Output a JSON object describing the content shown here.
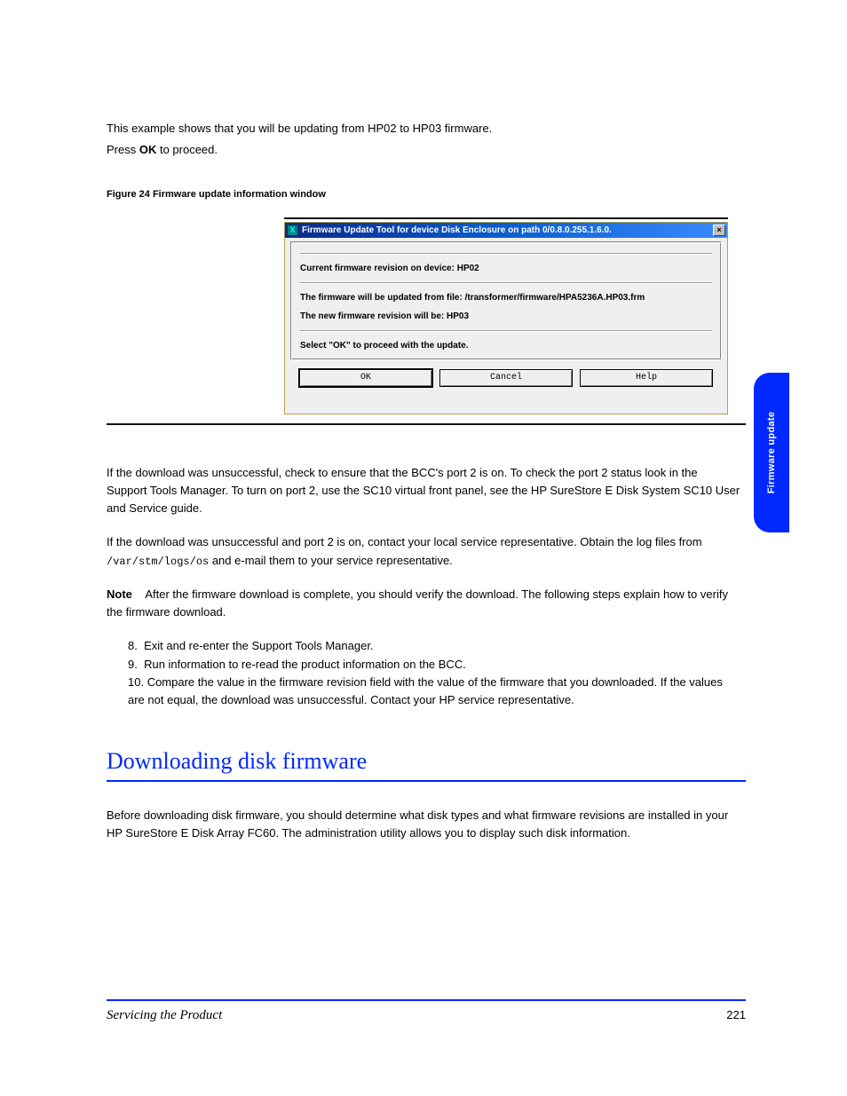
{
  "intro": {
    "line1": "This example shows that you will be updating from HP02 to HP03 firmware.",
    "line2_a": "Press ",
    "line2_btn": "OK",
    "line2_b": " to proceed."
  },
  "figure_caption": "Figure 24  Firmware update information window",
  "dialog": {
    "icon_letter": "X",
    "title": "Firmware Update Tool for device Disk Enclosure on path 0/0.8.0.255.1.6.0.",
    "close": "×",
    "lines": {
      "current": "Current firmware revision on device: HP02",
      "updated_from": "The firmware will be updated from file: /transformer/firmware/HPA5236A.HP03.frm",
      "new_rev": "The new firmware revision will be: HP03",
      "proceed": "Select \"OK\" to proceed with the update."
    },
    "buttons": {
      "ok": "OK",
      "cancel": "Cancel",
      "help": "Help"
    }
  },
  "side_tab": "Firmware update",
  "body": {
    "p1": "If the download was unsuccessful, check to ensure that the BCC's port 2 is on. To check the port 2 status look in the Support Tools Manager. To turn on port 2, use the SC10 virtual front panel, see the HP SureStore E Disk System SC10 User and Service guide.",
    "p2_a": "If the download was unsuccessful and port 2 is on, contact your local service representative. Obtain the log files from ",
    "p2_path": "/var/stm/logs/os",
    "p2_b": " and e-mail them to your service representative.",
    "note_label": "Note",
    "note_body": "After the firmware download is complete, you should verify the download. The following steps explain how to verify the firmware download.",
    "step8": "Exit and re-enter the Support Tools Manager.",
    "step9": "Run information to re-read the product information on the BCC.",
    "step10": "Compare the value in the firmware revision field with the value of the firmware that you downloaded. If the values are not equal, the download was unsuccessful. Contact your HP service representative."
  },
  "heading": "Downloading disk firmware",
  "heading_body": "Before downloading disk firmware, you should determine what disk types and what firmware revisions are installed in your HP SureStore E Disk Array FC60. The administration utility allows you to display such disk information.",
  "footer": {
    "title": "Servicing the Product",
    "page": "221"
  }
}
